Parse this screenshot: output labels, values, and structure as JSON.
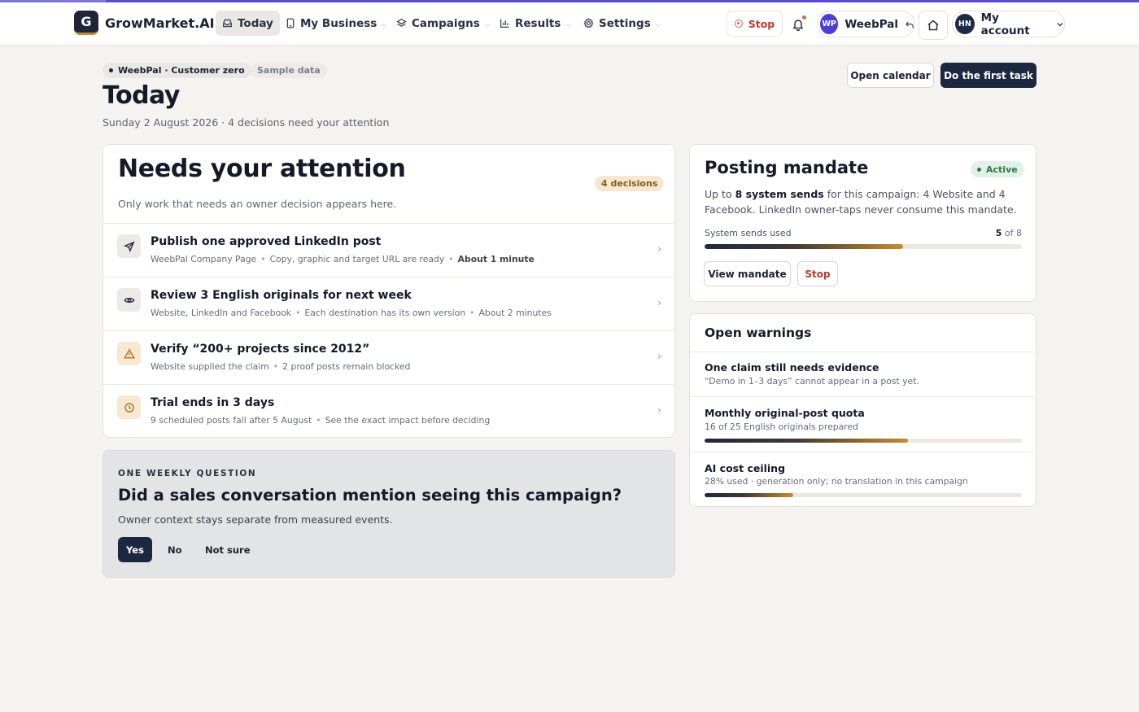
{
  "nav": {
    "logo_letter": "G",
    "brand": "GrowMarket.AI",
    "items": [
      {
        "label": "Today",
        "icon": "inbox-icon"
      },
      {
        "label": "My Business",
        "icon": "tablet-icon"
      },
      {
        "label": "Campaigns",
        "icon": "layers-icon"
      },
      {
        "label": "Results",
        "icon": "bar-chart-icon"
      },
      {
        "label": "Settings",
        "icon": "gear-icon"
      }
    ],
    "stop_label": "Stop",
    "workspace": {
      "initials": "WP",
      "name": "WeebPal"
    },
    "account": {
      "initials": "HN",
      "label": "My account"
    }
  },
  "header": {
    "workspace_pill": "WeebPal · Customer zero",
    "sample_pill": "Sample data",
    "title": "Today",
    "subtitle": "Sunday 2 August 2026 · 4 decisions need your attention",
    "open_calendar": "Open calendar",
    "first_task": "Do the first task"
  },
  "attention": {
    "title": "Needs your attention",
    "badge": "4 decisions",
    "description": "Only work that needs an owner decision appears here.",
    "rows": [
      {
        "icon": "send-icon",
        "title": "Publish one approved LinkedIn post",
        "meta": [
          "WeebPal Company Page",
          "Copy, graphic and target URL are ready"
        ],
        "meta_strong": "About 1 minute"
      },
      {
        "icon": "eye-icon",
        "title": "Review 3 English originals for next week",
        "meta": [
          "Website, LinkedIn and Facebook",
          "Each destination has its own version",
          "About 2 minutes"
        ]
      },
      {
        "icon": "warning-icon",
        "title": "Verify “200+ projects since 2012”",
        "meta": [
          "Website supplied the claim",
          "2 proof posts remain blocked"
        ]
      },
      {
        "icon": "clock-icon",
        "title": "Trial ends in 3 days",
        "meta": [
          "9 scheduled posts fall after 5 August",
          "See the exact impact before deciding"
        ]
      }
    ]
  },
  "question": {
    "eyebrow": "ONE WEEKLY QUESTION",
    "title": "Did a sales conversation mention seeing this campaign?",
    "description": "Owner context stays separate from measured events.",
    "options": [
      "Yes",
      "No",
      "Not sure"
    ]
  },
  "mandate": {
    "title": "Posting mandate",
    "status": "Active",
    "desc_prefix": "Up to ",
    "desc_strong": "8 system sends",
    "desc_suffix": " for this campaign: 4 Website and 4 Facebook. LinkedIn owner-taps never consume this mandate.",
    "sends_label": "System sends used",
    "sends_used": "5",
    "sends_total": "of 8",
    "sends_fraction": 0.625,
    "view_label": "View mandate",
    "stop_label": "Stop"
  },
  "warnings": {
    "title": "Open warnings",
    "items": [
      {
        "title": "One claim still needs evidence",
        "subtitle": "“Demo in 1–3 days” cannot appear in a post yet."
      },
      {
        "title": "Monthly original-post quota",
        "subtitle": "16 of 25 English originals prepared",
        "fraction": 0.64
      },
      {
        "title": "AI cost ceiling",
        "subtitle": "28% used · generation only; no translation in this campaign",
        "fraction": 0.28
      }
    ]
  },
  "colors": {
    "accent_dark": "#1c2740",
    "accent_amber": "#c98a2e",
    "stop_red": "#c0392b",
    "active_green": "#2c7a4b",
    "workspace_avatar": "#4b3fd6",
    "account_avatar": "#1e2a44"
  }
}
